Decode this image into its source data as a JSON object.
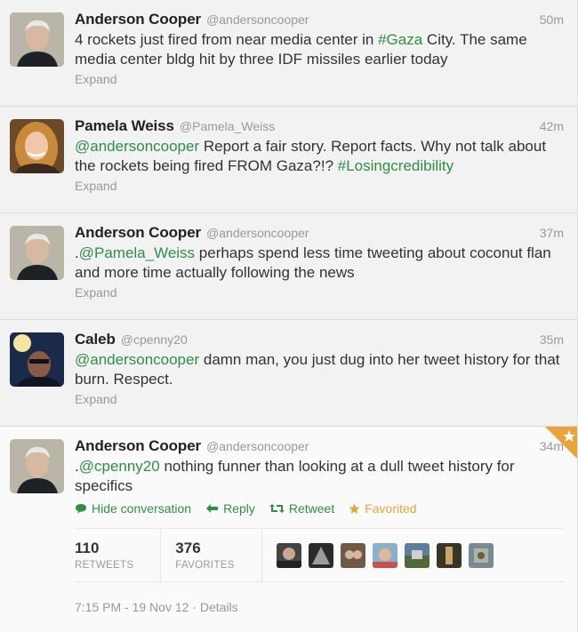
{
  "tweets": [
    {
      "name": "Anderson Cooper",
      "handle": "@andersoncooper",
      "time": "50m",
      "parts": [
        {
          "t": "4 rockets just fired from near media center in ",
          "link": false
        },
        {
          "t": "#Gaza",
          "link": true
        },
        {
          "t": " City. The same media center bldg hit by three IDF missiles earlier today",
          "link": false
        }
      ],
      "expand": "Expand"
    },
    {
      "name": "Pamela Weiss",
      "handle": "@Pamela_Weiss",
      "time": "42m",
      "parts": [
        {
          "t": "@andersoncooper",
          "link": true
        },
        {
          "t": " Report a fair story. Report facts. Why not talk about the rockets being fired FROM Gaza?!? ",
          "link": false
        },
        {
          "t": "#Losingcredibility",
          "link": true
        }
      ],
      "expand": "Expand"
    },
    {
      "name": "Anderson Cooper",
      "handle": "@andersoncooper",
      "time": "37m",
      "parts": [
        {
          "t": ".",
          "link": false
        },
        {
          "t": "@Pamela_Weiss",
          "link": true
        },
        {
          "t": " perhaps spend less time tweeting about coconut flan and more time actually following the news",
          "link": false
        }
      ],
      "expand": "Expand"
    },
    {
      "name": "Caleb",
      "handle": "@cpenny20",
      "time": "35m",
      "parts": [
        {
          "t": "@andersoncooper",
          "link": true
        },
        {
          "t": " damn man, you just dug into her tweet history for that burn. Respect.",
          "link": false
        }
      ],
      "expand": "Expand"
    }
  ],
  "focused": {
    "name": "Anderson Cooper",
    "handle": "@andersoncooper",
    "time": "34m",
    "parts": [
      {
        "t": ".",
        "link": false
      },
      {
        "t": "@cpenny20",
        "link": true
      },
      {
        "t": " nothing funner than looking at a dull tweet history for specifics",
        "link": false
      }
    ],
    "actions": {
      "hide": "Hide conversation",
      "reply": "Reply",
      "retweet": "Retweet",
      "favorited": "Favorited"
    },
    "stats": {
      "retweets_count": "110",
      "retweets_label": "RETWEETS",
      "favorites_count": "376",
      "favorites_label": "FAVORITES"
    },
    "meta": "7:15 PM - 19 Nov 12 · Details"
  },
  "colors": {
    "link": "#2f8e47",
    "favorite": "#e8a33d",
    "muted": "#999999"
  },
  "icons": [
    "chat-bubble-icon",
    "reply-arrow-icon",
    "retweet-icon",
    "star-icon",
    "favorited-corner-star-icon"
  ]
}
